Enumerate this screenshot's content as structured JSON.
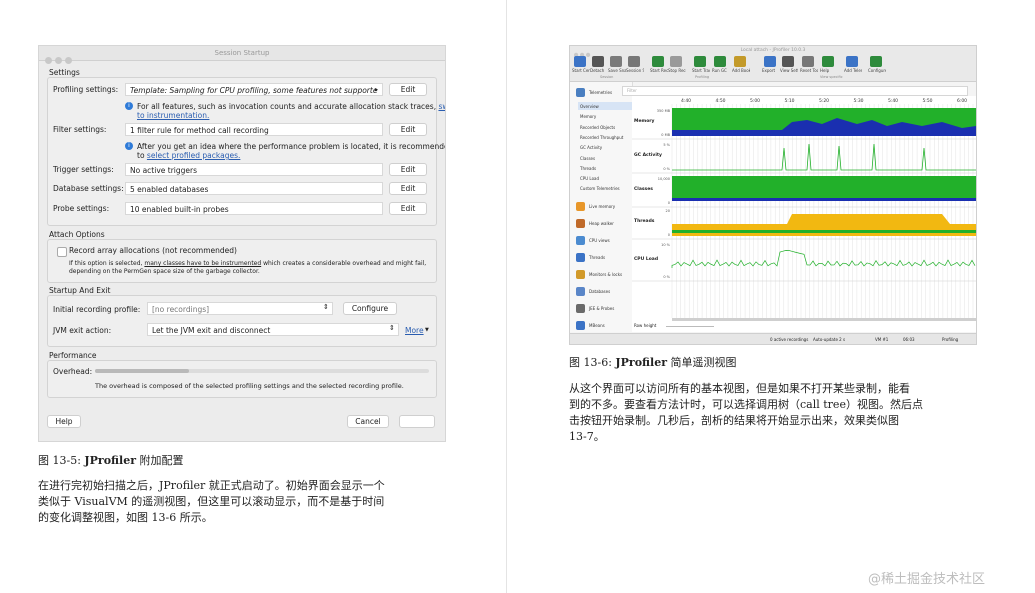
{
  "left_dialog": {
    "title": "Session Startup",
    "settings_group": "Settings",
    "rows": [
      {
        "label": "Profiling settings:",
        "value": "Template: Sampling for CPU profiling, some features not supporte",
        "button": "Edit"
      },
      {
        "label": "Filter settings:",
        "value": "1 filter rule for method call recording",
        "button": "Edit"
      },
      {
        "label": "Trigger settings:",
        "value": "No active triggers",
        "button": "Edit"
      },
      {
        "label": "Database settings:",
        "value": "5 enabled databases",
        "button": "Edit"
      },
      {
        "label": "Probe settings:",
        "value": "10 enabled built-in probes",
        "button": "Edit"
      }
    ],
    "info1_text": "For all features, such as invocation counts and accurate allocation stack traces,",
    "info1_link_a": "switch",
    "info1_link_b": "to instrumentation.",
    "info2_text": "After you get an idea where the performance problem is located, it is recommended",
    "info2_prefix": "to",
    "info2_link": "select profiled packages.",
    "attach_group": "Attach Options",
    "record_array": "Record array allocations (not recommended)",
    "attach_note_line1_a": "If this option is selected,",
    "attach_note_line1_b": "many classes have to be instrumented",
    "attach_note_line1_c": "which creates a considerable overhead and might fail,",
    "attach_note_line2": "depending on the PermGen space size of the garbage collector.",
    "startup_group": "Startup And Exit",
    "initial_label": "Initial recording profile:",
    "initial_value": "[no recordings]",
    "configure_button": "Configure",
    "jvm_exit_label": "JVM exit action:",
    "jvm_exit_value": "Let the JVM exit and disconnect",
    "more_link": "More",
    "performance_group": "Performance",
    "overhead_label": "Overhead:",
    "overhead_note": "The overhead is composed of the selected profiling settings and the selected recording profile.",
    "help_button": "Help",
    "cancel_button": "Cancel"
  },
  "left_caption": {
    "figure": "图 13-5:",
    "bold": "JProfiler",
    "rest": "附加配置"
  },
  "left_paragraph": [
    "在进行完初始扫描之后，JProfiler 就正式启动了。初始界面会显示一个",
    "类似于 VisualVM 的遥测视图，但这里可以滚动显示，而不是基于时间",
    "的变化调整视图，如图 13-6 所示。"
  ],
  "right_window": {
    "title": "Local attach - JProfiler 10.0.3",
    "toolbar": [
      "Start Center",
      "Detach",
      "Save Snapshot",
      "Session Settings",
      "Start Recordings",
      "Stop Recordings",
      "Start Tracking",
      "Run GC",
      "Add Bookmark",
      "Export",
      "View Settings",
      "Reset Tool",
      "Help",
      "Add Telemetry",
      "Configure Telemetries"
    ],
    "toolbar_groups": [
      "Session",
      "Profiling",
      "View specific"
    ],
    "filter_placeholder": "Filter",
    "sidebar_top": "Telemetries",
    "sidebar_items": [
      "Overview",
      "Memory",
      "Recorded Objects",
      "Recorded Throughput",
      "GC Activity",
      "Classes",
      "Threads",
      "CPU Load",
      "Custom Telemetries"
    ],
    "sidebar_sections": [
      "Live memory",
      "Heap walker",
      "CPU views",
      "Threads",
      "Monitors & locks",
      "Databases",
      "JEE & Probes",
      "MBeans"
    ],
    "time_ticks": [
      "4:40",
      "4:50",
      "5:00",
      "5:10",
      "5:20",
      "5:30",
      "5:40",
      "5:50",
      "6:00"
    ],
    "rows": [
      "Memory",
      "GC Activity",
      "Classes",
      "Threads",
      "CPU Load"
    ],
    "scale_labels": [
      "350 MB",
      "0 MB",
      "5 %",
      "0 %",
      "10,000",
      "0",
      "20",
      "0",
      "10 %",
      "0 %"
    ],
    "row_height_label": "Row height",
    "status": [
      "0 active recordings",
      "Auto-update 2 s",
      "VM #1",
      "06:03",
      "Profiling"
    ]
  },
  "right_caption": {
    "figure": "图 13-6:",
    "bold": "JProfiler",
    "rest": "简单遥测视图"
  },
  "right_paragraph": [
    "从这个界面可以访问所有的基本视图，但是如果不打开某些录制，能看",
    "到的不多。要查看方法计时，可以选择调用树（call tree）视图。然后点",
    "击按钮开始录制。几秒后，剖析的结果将开始显示出来，效果类似图",
    "13-7。"
  ],
  "watermark": "@稀土掘金技术社区"
}
